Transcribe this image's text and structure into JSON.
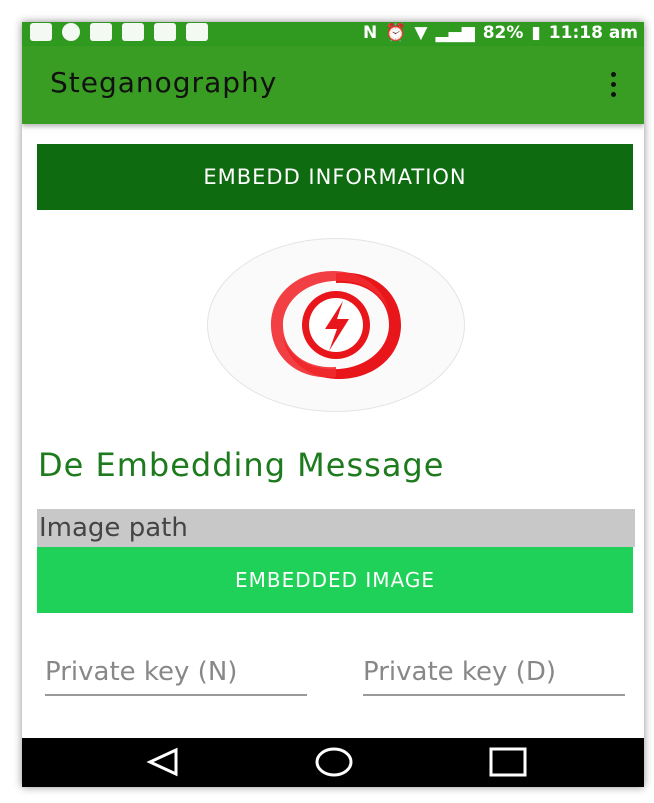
{
  "status_bar": {
    "battery": "82%",
    "time": "11:18 am",
    "icons": [
      "chat-icon",
      "clock-icon",
      "video-icon",
      "app-icon",
      "bible-icon",
      "nfc-icon",
      "alarm-icon",
      "wifi-icon",
      "signal-icon",
      "battery-icon"
    ]
  },
  "app_bar": {
    "title": "Steganography",
    "menu_icon": "more-vert-icon"
  },
  "buttons": {
    "embed": "EMBEDD INFORMATION",
    "embedded_image": "EMBEDDED IMAGE"
  },
  "logo": {
    "icon": "lightning-swirl-icon",
    "color": "#e8151b"
  },
  "section": {
    "title": "De Embedding Message"
  },
  "inputs": {
    "image_path": "Image path",
    "private_key_n": "Private key (N)",
    "private_key_d": "Private key (D)"
  },
  "nav_bar": {
    "icons": [
      "back-icon",
      "home-icon",
      "recents-icon"
    ]
  },
  "colors": {
    "app_bar": "#3a9d23",
    "embed_button": "#0e6b10",
    "image_button": "#1fd158",
    "title_text": "#1d7a1d"
  }
}
